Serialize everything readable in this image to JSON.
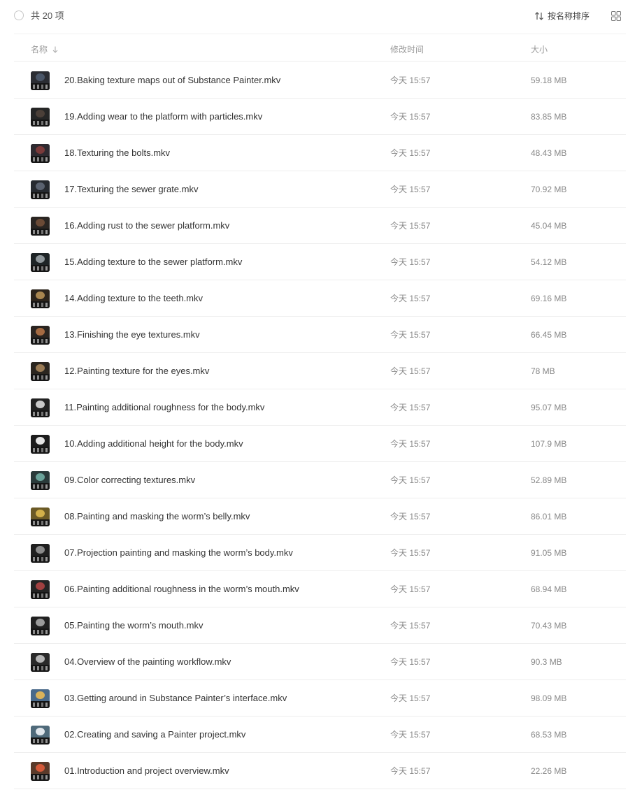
{
  "toolbar": {
    "count_label": "共 20 项",
    "sort_label": "按名称排序"
  },
  "columns": {
    "name": "名称",
    "modified": "修改时间",
    "size": "大小"
  },
  "files": [
    {
      "name": "20.Baking texture maps out of Substance Painter.mkv",
      "modified": "今天 15:57",
      "size": "59.18 MB",
      "thumb": {
        "bg": "#2b2d33",
        "obj": "#4a5668"
      }
    },
    {
      "name": "19.Adding wear to the platform with particles.mkv",
      "modified": "今天 15:57",
      "size": "83.85 MB",
      "thumb": {
        "bg": "#262626",
        "obj": "#4b3f38"
      }
    },
    {
      "name": "18.Texturing the bolts.mkv",
      "modified": "今天 15:57",
      "size": "48.43 MB",
      "thumb": {
        "bg": "#2e2a30",
        "obj": "#7a3a3a"
      }
    },
    {
      "name": "17.Texturing the sewer grate.mkv",
      "modified": "今天 15:57",
      "size": "70.92 MB",
      "thumb": {
        "bg": "#262a30",
        "obj": "#5a6270"
      }
    },
    {
      "name": "16.Adding rust to the sewer platform.mkv",
      "modified": "今天 15:57",
      "size": "45.04 MB",
      "thumb": {
        "bg": "#2a2522",
        "obj": "#6b4a36"
      }
    },
    {
      "name": "15.Adding texture to the sewer platform.mkv",
      "modified": "今天 15:57",
      "size": "54.12 MB",
      "thumb": {
        "bg": "#1e2426",
        "obj": "#8e969a"
      }
    },
    {
      "name": "14.Adding texture to the teeth.mkv",
      "modified": "今天 15:57",
      "size": "69.16 MB",
      "thumb": {
        "bg": "#2c241c",
        "obj": "#a8854f"
      }
    },
    {
      "name": "13.Finishing the eye textures.mkv",
      "modified": "今天 15:57",
      "size": "66.45 MB",
      "thumb": {
        "bg": "#2a2420",
        "obj": "#a56a42"
      }
    },
    {
      "name": "12.Painting texture for the eyes.mkv",
      "modified": "今天 15:57",
      "size": "78 MB",
      "thumb": {
        "bg": "#2b2620",
        "obj": "#9a7b55"
      }
    },
    {
      "name": "11.Painting additional roughness for the body.mkv",
      "modified": "今天 15:57",
      "size": "95.07 MB",
      "thumb": {
        "bg": "#222222",
        "obj": "#c9c9c9"
      }
    },
    {
      "name": "10.Adding additional height for the body.mkv",
      "modified": "今天 15:57",
      "size": "107.9 MB",
      "thumb": {
        "bg": "#1c1c1c",
        "obj": "#e4e4e4"
      }
    },
    {
      "name": "09.Color correcting textures.mkv",
      "modified": "今天 15:57",
      "size": "52.89 MB",
      "thumb": {
        "bg": "#2a3a3a",
        "obj": "#6aa39a"
      }
    },
    {
      "name": "08.Painting and masking the worm’s belly.mkv",
      "modified": "今天 15:57",
      "size": "86.01 MB",
      "thumb": {
        "bg": "#6b5a26",
        "obj": "#d2b04a"
      }
    },
    {
      "name": "07.Projection painting and masking the worm’s body.mkv",
      "modified": "今天 15:57",
      "size": "91.05 MB",
      "thumb": {
        "bg": "#1f1f1f",
        "obj": "#8a8a8a"
      }
    },
    {
      "name": "06.Painting additional roughness in the worm’s mouth.mkv",
      "modified": "今天 15:57",
      "size": "68.94 MB",
      "thumb": {
        "bg": "#242424",
        "obj": "#a04040"
      }
    },
    {
      "name": "05.Painting the worm’s mouth.mkv",
      "modified": "今天 15:57",
      "size": "70.43 MB",
      "thumb": {
        "bg": "#202020",
        "obj": "#9a9a9a"
      }
    },
    {
      "name": "04.Overview of the painting workflow.mkv",
      "modified": "今天 15:57",
      "size": "90.3 MB",
      "thumb": {
        "bg": "#2a2a2a",
        "obj": "#b5b5b5"
      }
    },
    {
      "name": "03.Getting around in Substance Painter’s interface.mkv",
      "modified": "今天 15:57",
      "size": "98.09 MB",
      "thumb": {
        "bg": "#4a6a8a",
        "obj": "#d9b25a"
      }
    },
    {
      "name": "02.Creating and saving a Painter project.mkv",
      "modified": "今天 15:57",
      "size": "68.53 MB",
      "thumb": {
        "bg": "#4f6a7a",
        "obj": "#dfe5ea"
      }
    },
    {
      "name": "01.Introduction and project overview.mkv",
      "modified": "今天 15:57",
      "size": "22.26 MB",
      "thumb": {
        "bg": "#5a3a2a",
        "obj": "#d45a3a"
      }
    }
  ]
}
